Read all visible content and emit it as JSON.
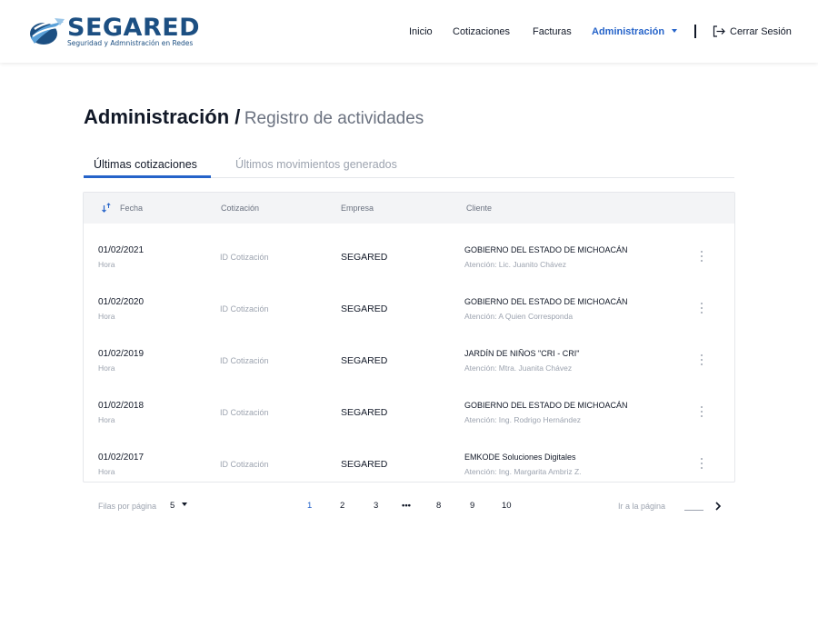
{
  "brand": {
    "name": "SEGARED",
    "tagline": "Seguridad y Admnistración en Redes",
    "colors": {
      "primary": "#1c4f82",
      "accent": "#2563c9",
      "logo_light": "#5aa0d8"
    }
  },
  "nav": {
    "items": [
      "Inicio",
      "Cotizaciones",
      "Facturas"
    ],
    "active": "Administración",
    "logout": "Cerrar Sesión"
  },
  "page": {
    "title": "Administración /",
    "subtitle": "Registro de actividades"
  },
  "tabs": [
    "Últimas cotizaciones",
    "Últimos movimientos generados"
  ],
  "table": {
    "headers": [
      "Fecha",
      "Cotización",
      "Empresa",
      "Cliente"
    ],
    "rows": [
      {
        "date": "01/02/2021",
        "time": "Hora",
        "id": "ID Cotización",
        "company": "SEGARED",
        "client": "GOBIERNO DEL ESTADO DE MICHOACÁN",
        "attention": "Atención: Lic. Juanito Chávez"
      },
      {
        "date": "01/02/2020",
        "time": "Hora",
        "id": "ID Cotización",
        "company": "SEGARED",
        "client": "GOBIERNO DEL ESTADO DE MICHOACÁN",
        "attention": "Atención: A Quien Corresponda"
      },
      {
        "date": "01/02/2019",
        "time": "Hora",
        "id": "ID Cotización",
        "company": "SEGARED",
        "client": "JARDÍN DE NIÑOS \"CRI - CRI\"",
        "attention": "Atención: Mtra. Juanita Chávez"
      },
      {
        "date": "01/02/2018",
        "time": "Hora",
        "id": "ID Cotización",
        "company": "SEGARED",
        "client": "GOBIERNO DEL ESTADO DE MICHOACÁN",
        "attention": "Atención: Ing. Rodrigo Hernández"
      },
      {
        "date": "01/02/2017",
        "time": "Hora",
        "id": "ID Cotización",
        "company": "SEGARED",
        "client": "EMKODE Soluciones Digitales",
        "attention": "Atención: Ing. Margarita Ambriz Z."
      }
    ]
  },
  "pagination": {
    "rows_per_page_label": "Filas por página",
    "rows_per_page_value": "5",
    "pages": [
      "1",
      "2",
      "3",
      "8",
      "9",
      "10"
    ],
    "ellipsis": "•••",
    "current_page": "1",
    "goto_label": "Ir a la página"
  }
}
